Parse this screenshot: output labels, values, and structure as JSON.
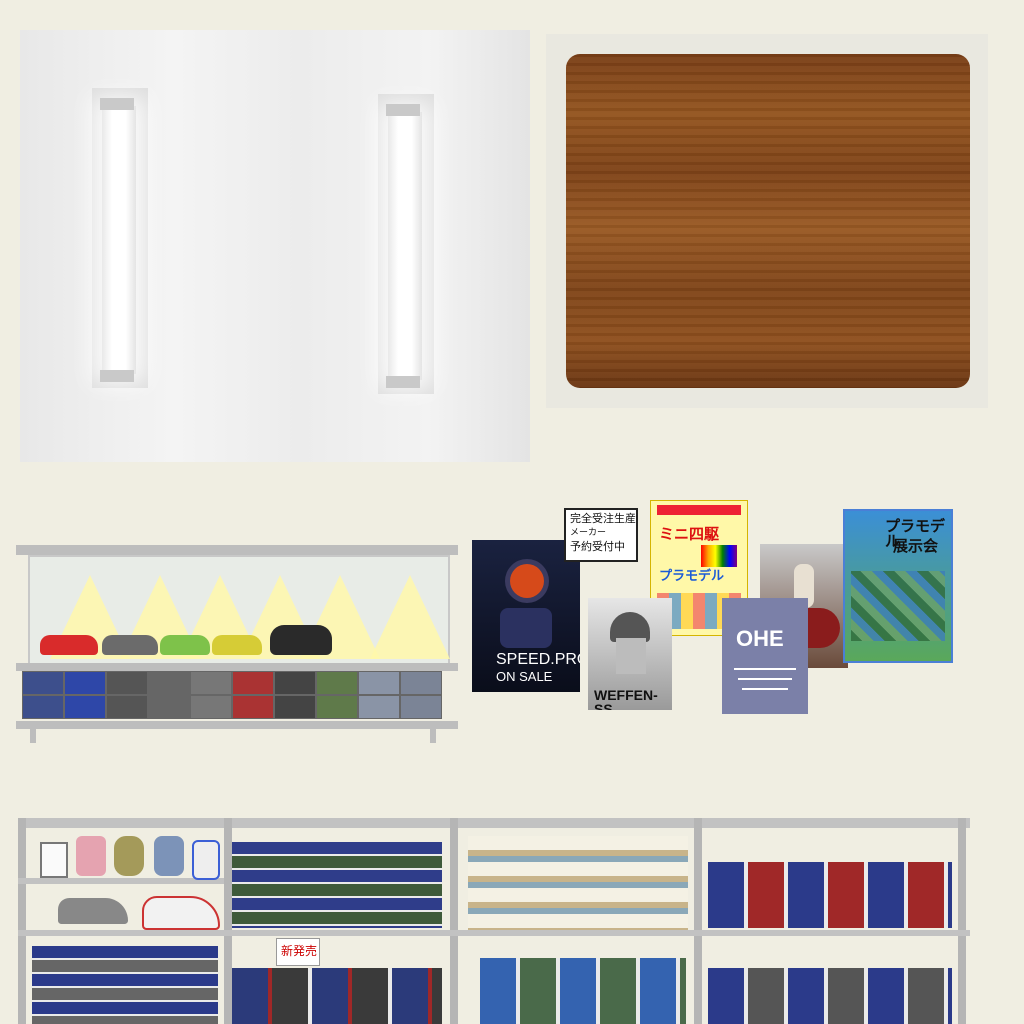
{
  "ceiling": {
    "lamps": [
      "lamp-left",
      "lamp-right"
    ]
  },
  "wood_panel": {
    "color": "#8a4c1c"
  },
  "display_case": {
    "car_colors": [
      "#d92b2b",
      "#6b6b6b",
      "#7ec24a",
      "#d6cc36",
      "#2a2a2a"
    ]
  },
  "posters": {
    "speed_pros": {
      "line1": "SPEED.PROS",
      "line2": "ON SALE"
    },
    "notice": {
      "line1": "完全受注生産",
      "line2": "メーカー",
      "line3": "予約受付中"
    },
    "mini4wd": {
      "line1": "ミニ四駆",
      "line2": "プラモデル"
    },
    "weffen": {
      "text": "WEFFEN-SS"
    },
    "ohe": {
      "text": "OHE"
    },
    "plamodel": {
      "line1": "プラモデル",
      "line2": "展示会"
    }
  },
  "shelf_sign": {
    "text": "新発売"
  }
}
